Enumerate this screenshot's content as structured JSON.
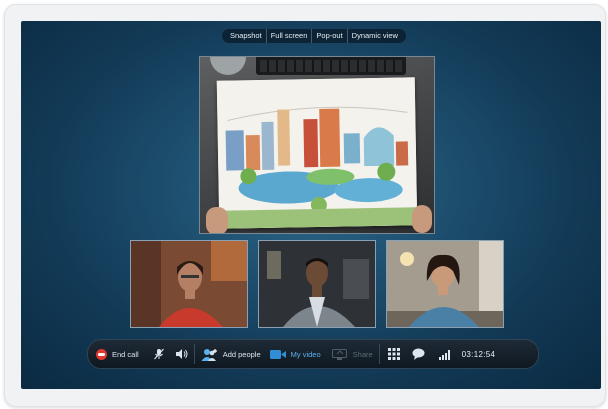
{
  "view_controls": {
    "snapshot": "Snapshot",
    "full_screen": "Full screen",
    "pop_out": "Pop-out",
    "dynamic_view": "Dynamic view"
  },
  "call_controls": {
    "end_call": "End call",
    "add_people": "Add people",
    "my_video": "My video",
    "share": "Share",
    "timer": "03:12:54"
  },
  "icons": {
    "end_call": "phone-hangup-icon",
    "mute": "microphone-muted-icon",
    "volume": "speaker-icon",
    "add_people": "add-people-icon",
    "video": "video-camera-icon",
    "share": "share-screen-icon",
    "dialpad": "dialpad-icon",
    "chat": "chat-bubble-icon",
    "signal": "call-quality-icon"
  },
  "colors": {
    "accent": "#5bb0ef",
    "end_call": "#e0372f",
    "stage": "#1d4e6e"
  }
}
